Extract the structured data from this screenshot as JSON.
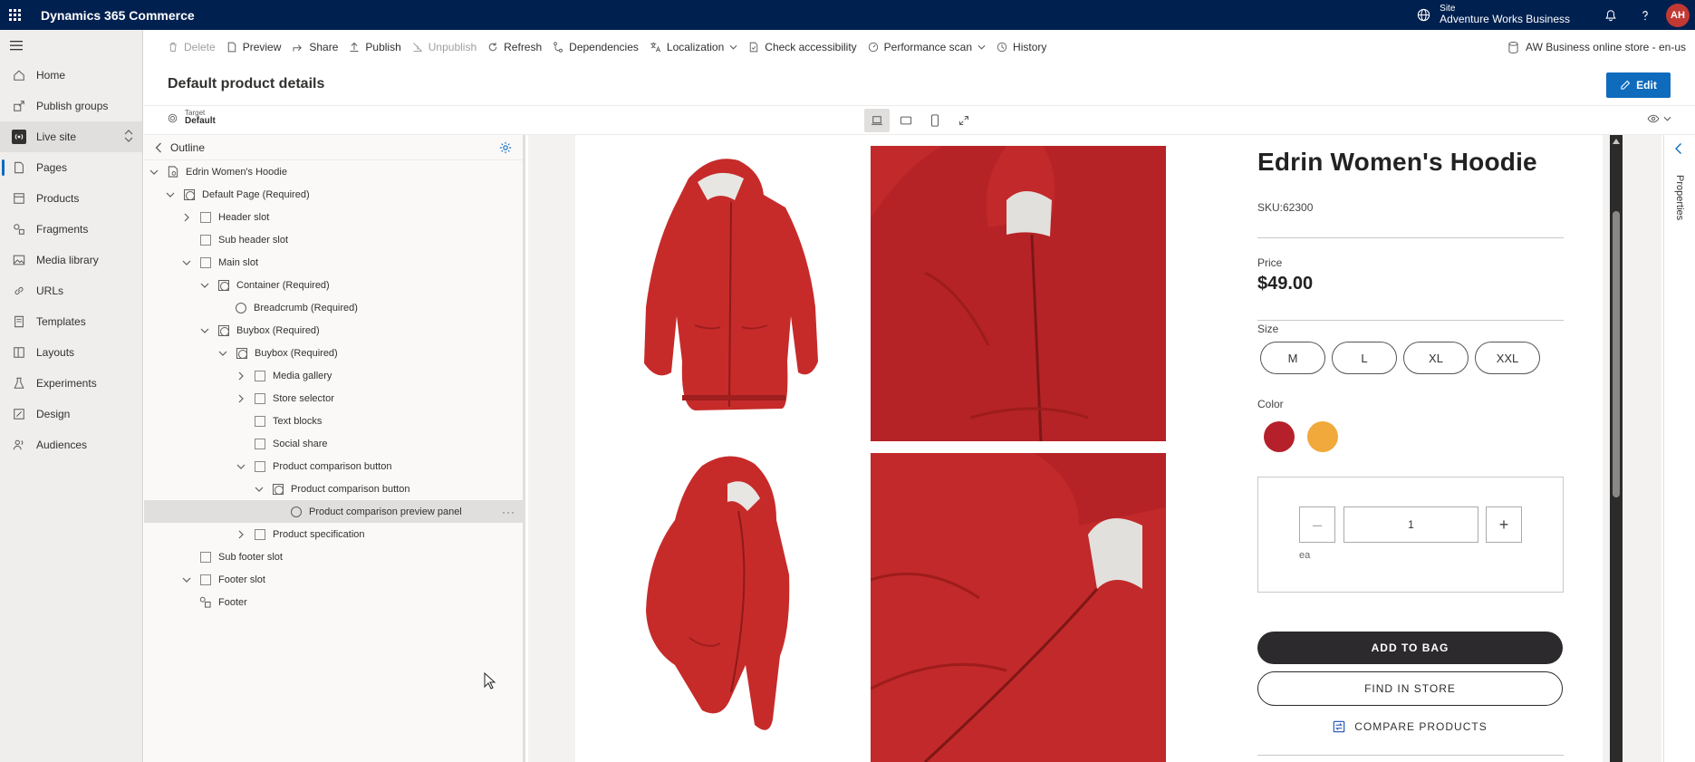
{
  "app": {
    "title": "Dynamics 365 Commerce"
  },
  "header": {
    "site_label": "Site",
    "site_name": "Adventure Works Business",
    "user_initials": "AH"
  },
  "nav": {
    "items": [
      {
        "label": "Home",
        "icon": "home-icon"
      },
      {
        "label": "Publish groups",
        "icon": "publish-groups-icon"
      },
      {
        "label": "Live site",
        "icon": "live-site-icon"
      },
      {
        "label": "Pages",
        "icon": "pages-icon"
      },
      {
        "label": "Products",
        "icon": "products-icon"
      },
      {
        "label": "Fragments",
        "icon": "fragments-icon"
      },
      {
        "label": "Media library",
        "icon": "media-library-icon"
      },
      {
        "label": "URLs",
        "icon": "urls-icon"
      },
      {
        "label": "Templates",
        "icon": "templates-icon"
      },
      {
        "label": "Layouts",
        "icon": "layouts-icon"
      },
      {
        "label": "Experiments",
        "icon": "experiments-icon"
      },
      {
        "label": "Design",
        "icon": "design-icon"
      },
      {
        "label": "Audiences",
        "icon": "audiences-icon"
      }
    ],
    "active": "Pages"
  },
  "toolbar": {
    "delete": "Delete",
    "preview": "Preview",
    "share": "Share",
    "publish": "Publish",
    "unpublish": "Unpublish",
    "refresh": "Refresh",
    "dependencies": "Dependencies",
    "localization": "Localization",
    "check_accessibility": "Check accessibility",
    "performance_scan": "Performance scan",
    "history": "History",
    "store": "AW Business online store - en-us"
  },
  "page": {
    "title": "Default product details",
    "edit_label": "Edit",
    "target_label": "Target",
    "target_value": "Default"
  },
  "outline": {
    "title": "Outline",
    "nodes": [
      "Edrin Women's Hoodie",
      "Default Page (Required)",
      "Header slot",
      "Sub header slot",
      "Main slot",
      "Container (Required)",
      "Breadcrumb (Required)",
      "Buybox (Required)",
      "Buybox (Required)",
      "Media gallery",
      "Store selector",
      "Text blocks",
      "Social share",
      "Product comparison button",
      "Product comparison button",
      "Product comparison preview panel",
      "Product specification",
      "Sub footer slot",
      "Footer slot",
      "Footer"
    ],
    "more": "···"
  },
  "product": {
    "name": "Edrin Women's Hoodie",
    "sku": "SKU:62300",
    "price_label": "Price",
    "price": "$49.00",
    "size_label": "Size",
    "sizes": [
      "M",
      "L",
      "XL",
      "XXL"
    ],
    "color_label": "Color",
    "colors": [
      "#b5202a",
      "#f0a93a"
    ],
    "quantity": "1",
    "quantity_unit": "ea",
    "add_to_bag": "ADD TO BAG",
    "find_in_store": "FIND IN STORE",
    "compare": "COMPARE PRODUCTS"
  },
  "properties": {
    "label": "Properties"
  }
}
